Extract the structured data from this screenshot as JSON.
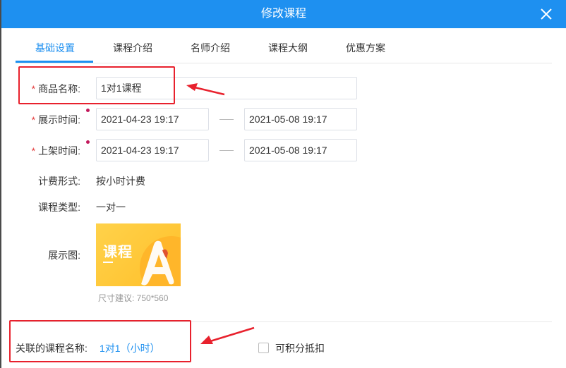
{
  "dialog": {
    "title": "修改课程",
    "close_icon": "close-icon"
  },
  "tabs": [
    {
      "label": "基础设置",
      "active": true
    },
    {
      "label": "课程介绍",
      "active": false
    },
    {
      "label": "名师介绍",
      "active": false
    },
    {
      "label": "课程大纲",
      "active": false
    },
    {
      "label": "优惠方案",
      "active": false
    }
  ],
  "form": {
    "product_name": {
      "label": "商品名称:",
      "required": "*",
      "value": "1对1课程"
    },
    "display_time": {
      "label": "展示时间:",
      "required": "*",
      "start": "2021-04-23 19:17",
      "end": "2021-05-08 19:17"
    },
    "listing_time": {
      "label": "上架时间:",
      "required": "*",
      "start": "2021-04-23 19:17",
      "end": "2021-05-08 19:17"
    },
    "billing": {
      "label": "计费形式:",
      "value": "按小时计费"
    },
    "course_type": {
      "label": "课程类型:",
      "value": "一对一"
    },
    "display_image": {
      "label": "展示图:",
      "thumb_text": "课程",
      "size_hint": "尺寸建议: 750*560"
    }
  },
  "related": {
    "label": "关联的课程名称:",
    "link_text": "1对1（小时）",
    "checkbox_label": "可积分抵扣"
  },
  "colors": {
    "header": "#1e90f0",
    "accent": "#1e90f0",
    "annotation": "#e8212d",
    "required": "#e43c3c"
  }
}
